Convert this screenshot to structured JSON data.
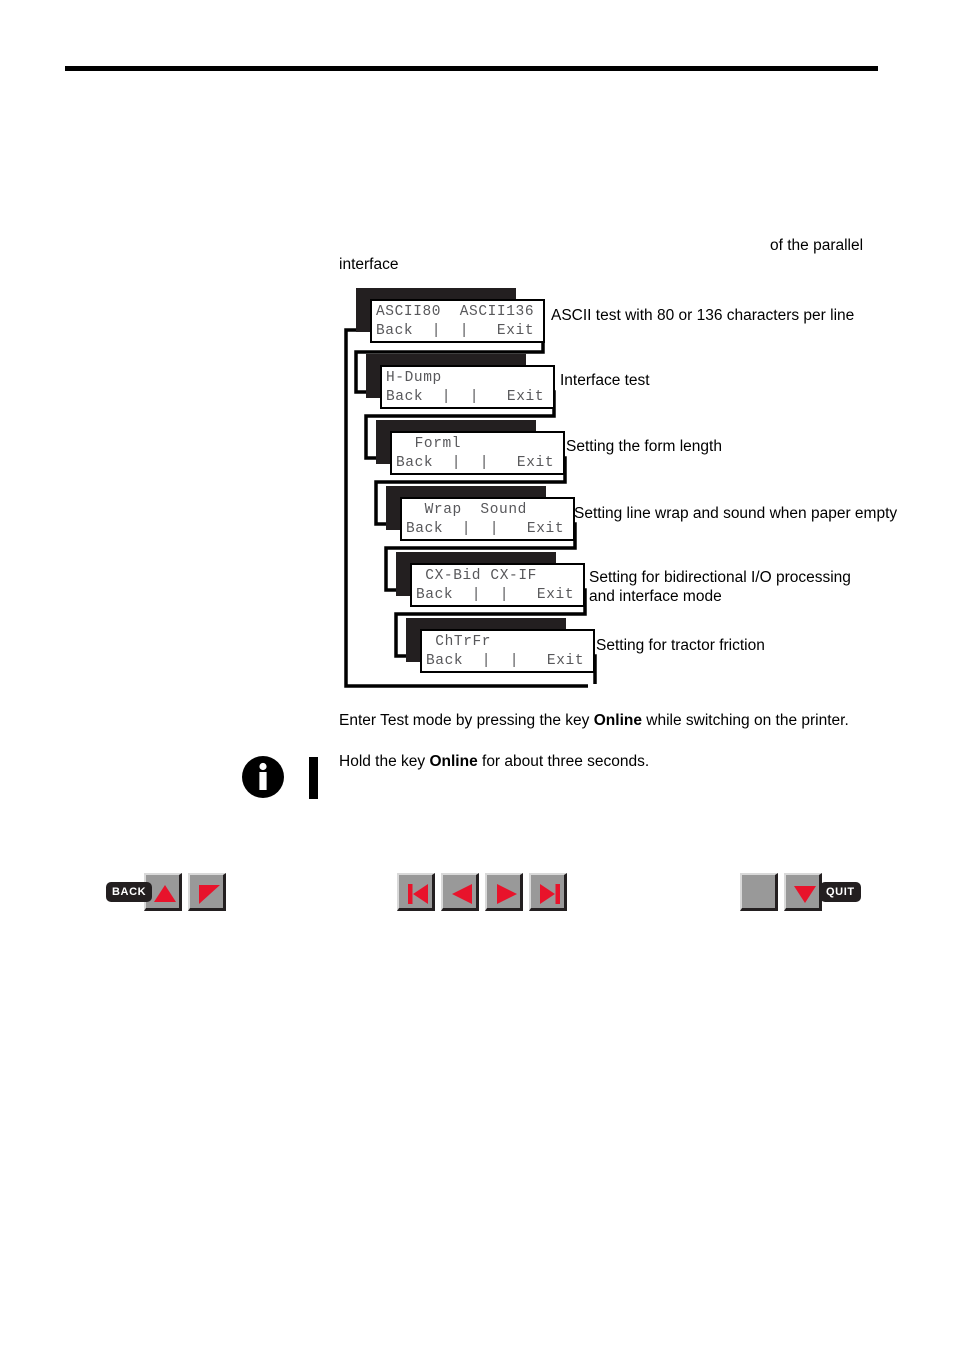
{
  "page": {
    "intro_fragment_right": "of the parallel",
    "intro_fragment_left": "interface"
  },
  "menu_flow": {
    "items": [
      {
        "lcd_top": "ASCII80  ASCII136",
        "lcd_bottom": "Back  |  |   Exit",
        "description": "ASCII test with 80 or 136 characters per line"
      },
      {
        "lcd_top": "H-Dump",
        "lcd_bottom": "Back  |  |   Exit",
        "description": "Interface test"
      },
      {
        "lcd_top": "  Forml",
        "lcd_bottom": "Back  |  |   Exit",
        "description": "Setting the form length"
      },
      {
        "lcd_top": "  Wrap  Sound",
        "lcd_bottom": "Back  |  |   Exit",
        "description": "Setting line wrap and sound when paper empty"
      },
      {
        "lcd_top": " CX-Bid CX-IF",
        "lcd_bottom": "Back  |  |   Exit",
        "description": "Setting for bidirectional I/O processing\nand interface mode"
      },
      {
        "lcd_top": " ChTrFr",
        "lcd_bottom": "Back  |  |   Exit",
        "description": "Setting for tractor friction"
      }
    ]
  },
  "notes": {
    "enter_prefix": "Enter Test mode by pressing the key ",
    "enter_key": "Online",
    "enter_suffix": " while switching on the printer.",
    "hold_prefix": "Hold the key ",
    "hold_key": "Online",
    "hold_suffix": " for about three seconds."
  },
  "key_legend": {
    "left": {
      "pill_label": "BACK",
      "keys": [
        "triangle-up-key",
        "triangle-corner-key"
      ]
    },
    "middle": {
      "keys": [
        "skip-back-key",
        "previous-key",
        "next-key",
        "skip-forward-key"
      ]
    },
    "right": {
      "pill_label": "QUIT",
      "keys": [
        "blank-key",
        "triangle-down-key"
      ]
    }
  },
  "colors": {
    "accent_red": "#e8132b",
    "key_face": "#999999",
    "lcd_text": "#58585b",
    "ink": "#231f20"
  }
}
